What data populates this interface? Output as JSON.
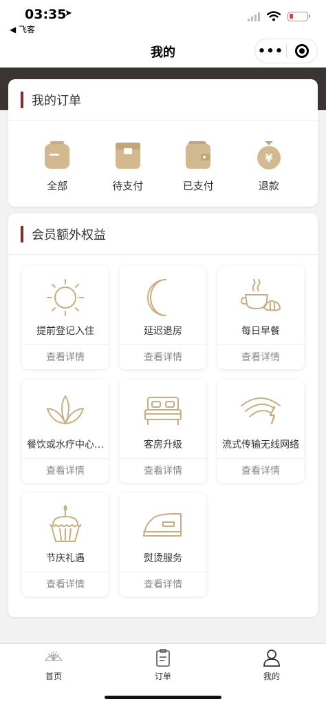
{
  "status_bar": {
    "time": "03:35",
    "location_arrow": "➤",
    "back_app": "◀ 飞客"
  },
  "nav": {
    "title": "我的",
    "more_icon": "more-dots-icon",
    "close_icon": "mini-program-close-icon"
  },
  "colors": {
    "accent_bar": "#8a2b20",
    "icon_gold": "#c9ad7f",
    "header_dark": "#3a3532"
  },
  "orders": {
    "title": "我的订单",
    "items": [
      {
        "label": "全部",
        "icon": "all-orders-icon"
      },
      {
        "label": "待支付",
        "icon": "pending-payment-icon"
      },
      {
        "label": "已支付",
        "icon": "paid-wallet-icon"
      },
      {
        "label": "退款",
        "icon": "refund-yen-icon"
      }
    ]
  },
  "benefits": {
    "title": "会员额外权益",
    "detail_label": "查看详情",
    "items": [
      {
        "label": "提前登记入住",
        "icon": "sun-icon"
      },
      {
        "label": "延迟退房",
        "icon": "moon-icon"
      },
      {
        "label": "每日早餐",
        "icon": "coffee-croissant-icon"
      },
      {
        "label": "餐饮或水疗中心…",
        "icon": "lotus-icon"
      },
      {
        "label": "客房升级",
        "icon": "bed-icon"
      },
      {
        "label": "流式传输无线网络",
        "icon": "wifi-bolt-icon"
      },
      {
        "label": "节庆礼遇",
        "icon": "cake-icon"
      },
      {
        "label": "熨烫服务",
        "icon": "iron-icon"
      }
    ]
  },
  "tab_bar": {
    "items": [
      {
        "label": "首页",
        "icon": "home-fan-icon"
      },
      {
        "label": "订单",
        "icon": "clipboard-icon"
      },
      {
        "label": "我的",
        "icon": "person-icon"
      }
    ]
  }
}
